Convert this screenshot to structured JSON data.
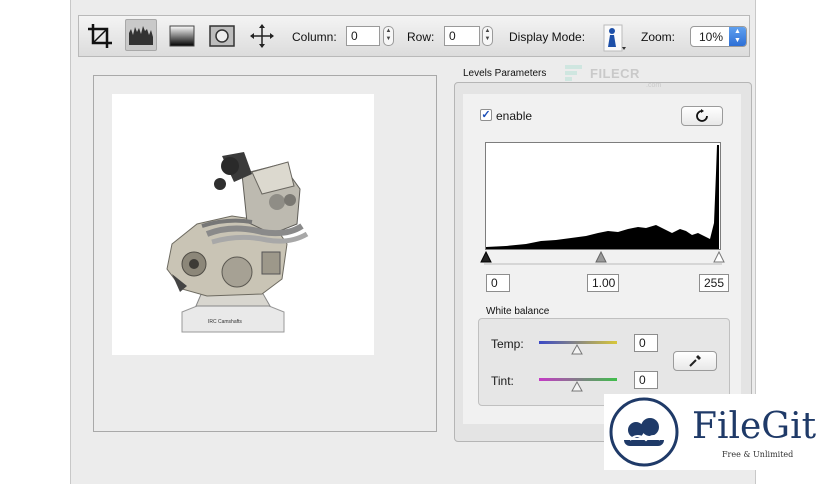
{
  "toolbar": {
    "column_label": "Column:",
    "column_value": "0",
    "row_label": "Row:",
    "row_value": "0",
    "display_mode_label": "Display Mode:",
    "zoom_label": "Zoom:",
    "zoom_value": "10%"
  },
  "preview": {
    "caption": "IRC Camshafts"
  },
  "levels": {
    "group_label": "Levels Parameters",
    "enable_label": "enable",
    "enabled": true,
    "black_point": "0",
    "gamma": "1.00",
    "white_point": "255"
  },
  "white_balance": {
    "group_label": "White balance",
    "temp_label": "Temp:",
    "temp_value": "0",
    "tint_label": "Tint:",
    "tint_value": "0"
  },
  "watermarks": {
    "filecr_text": "FILECR",
    "filecr_sub": ".com",
    "filegit_title": "FileGit",
    "filegit_tagline": "Free & Unlimited"
  },
  "colors": {
    "accent_blue": "#2d6fd6",
    "filegit_navy": "#1f3a68"
  }
}
